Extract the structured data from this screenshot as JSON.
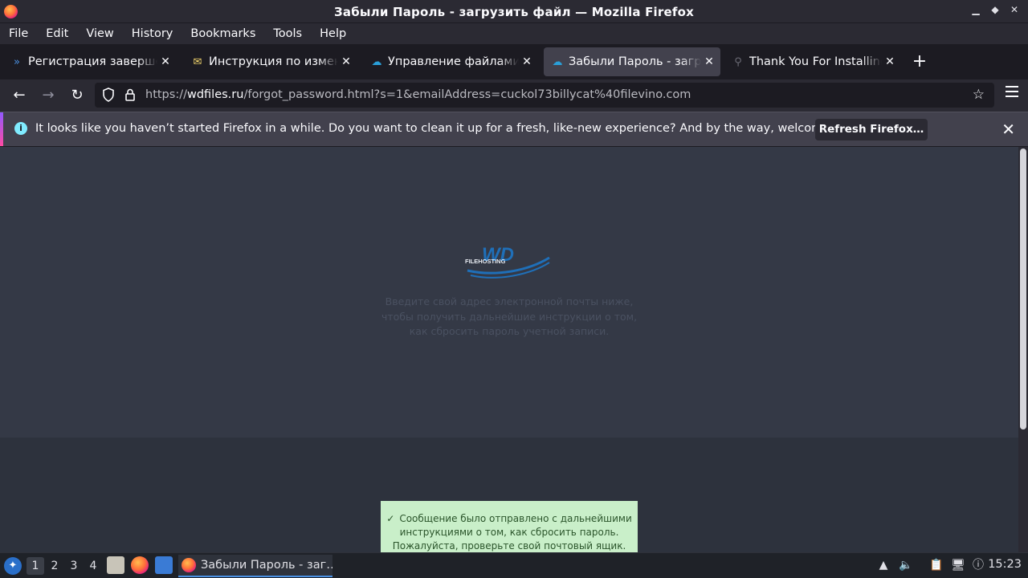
{
  "window": {
    "title": "Забыли Пароль - загрузить файл — Mozilla Firefox",
    "minimize": "▁",
    "maximize": "◆",
    "close": "✕"
  },
  "menu": [
    "File",
    "Edit",
    "View",
    "History",
    "Bookmarks",
    "Tools",
    "Help"
  ],
  "tabs": [
    {
      "label": "Регистрация завершена",
      "icon": "double-chevron-icon",
      "icon_glyph": "»",
      "icon_color": "#4a90e2",
      "active": false
    },
    {
      "label": "Инструкция по изменению",
      "icon": "envelope-icon",
      "icon_glyph": "✉",
      "icon_color": "#f5d76e",
      "active": false
    },
    {
      "label": "Управление файлами -",
      "icon": "cloud-icon",
      "icon_glyph": "☁",
      "icon_color": "#2a9fd8",
      "active": false
    },
    {
      "label": "Забыли Пароль - загрузить",
      "icon": "cloud-icon",
      "icon_glyph": "☁",
      "icon_color": "#2a9fd8",
      "active": true
    },
    {
      "label": "Thank You For Installing!",
      "icon": "search-icon",
      "icon_glyph": "⚲",
      "icon_color": "#6b6b75",
      "active": false
    }
  ],
  "tab_close_glyph": "✕",
  "new_tab_glyph": "+",
  "nav": {
    "back": "←",
    "forward": "→",
    "reload": "↻",
    "url_prefix": "https://",
    "url_host": "wdfiles.ru",
    "url_path": "/forgot_password.html?s=1&emailAddress=cuckol73billycat%40filevino.com",
    "star": "☆"
  },
  "infobar": {
    "text": "It looks like you haven’t started Firefox in a while. Do you want to clean it up for a fresh, like-new experience? And by the way, welcome back!",
    "button": "Refresh Firefox…",
    "close": "✕"
  },
  "page": {
    "logo_text": "WD",
    "logo_sub": "FILEHOSTING",
    "instructions": "Введите свой адрес электронной почты ниже, чтобы получить дальнейшие инструкции о том, как сбросить пароль учетной записи.",
    "toast_check": "✓",
    "toast_text": "Сообщение было отправлено с дальнейшими инструкциями о том, как сбросить пароль. Пожалуйста, проверьте свой почтовый ящик.",
    "colors": {
      "logo_blue": "#1f6fb8",
      "toast_bg": "#c9efc9"
    }
  },
  "taskbar": {
    "workspaces": [
      "1",
      "2",
      "3",
      "4"
    ],
    "active_workspace": "1",
    "task_label": "Забыли Пароль - заг…",
    "clock": "15:23"
  }
}
